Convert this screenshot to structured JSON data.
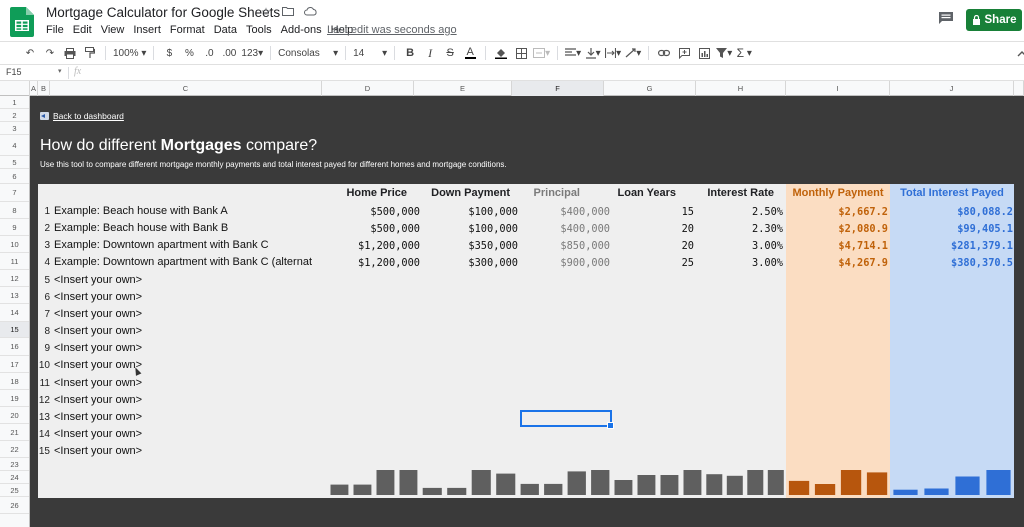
{
  "app": {
    "title": "Mortgage Calculator for Google Sheets",
    "menu": [
      "File",
      "Edit",
      "View",
      "Insert",
      "Format",
      "Data",
      "Tools",
      "Add-ons",
      "Help"
    ],
    "last_edit": "Last edit was seconds ago",
    "share_label": "Share",
    "icons": [
      "star-icon",
      "move-to-folder-icon",
      "cloud-status-icon",
      "comment-history-icon"
    ]
  },
  "toolbar": {
    "zoom": "100%",
    "currency": "$",
    "percent": "%",
    "dec_decrease": ".0",
    "dec_increase": ".00",
    "more_formats": "123",
    "font": "Consolas",
    "font_size": "14",
    "bold": "B",
    "italic": "I",
    "strike": "S",
    "text_color": "A",
    "function": "Σ"
  },
  "formula_bar": {
    "cell_ref": "F15",
    "fx": "fx",
    "value": ""
  },
  "columns": [
    "A",
    "B",
    "C",
    "D",
    "E",
    "F",
    "G",
    "H",
    "I",
    "J"
  ],
  "selected_column": "F",
  "rows": [
    "1",
    "2",
    "3",
    "4",
    "5",
    "6",
    "7",
    "8",
    "9",
    "10",
    "11",
    "12",
    "13",
    "14",
    "15",
    "16",
    "17",
    "18",
    "19",
    "20",
    "21",
    "22",
    "23",
    "24",
    "25",
    "26"
  ],
  "selected_row": "15",
  "sheet": {
    "back_link": "Back to dashboard",
    "heading_prefix": "How do different ",
    "heading_bold": "Mortgages",
    "heading_suffix": " compare?",
    "subheading": "Use this tool to compare different mortgage monthly payments and total interest payed for different homes and mortgage conditions."
  },
  "table": {
    "headers": {
      "home_price": "Home Price",
      "down_payment": "Down Payment",
      "principal": "Principal",
      "loan_years": "Loan Years",
      "interest_rate": "Interest Rate",
      "monthly_payment": "Monthly Payment",
      "total_interest": "Total Interest Payed"
    },
    "rows": [
      {
        "idx": "1",
        "name": "Example: Beach house with Bank A",
        "home_price": "$500,000",
        "down_payment": "$100,000",
        "principal": "$400,000",
        "loan_years": "15",
        "interest_rate": "2.50%",
        "monthly_payment": "$2,667.2",
        "total_interest": "$80,088.2"
      },
      {
        "idx": "2",
        "name": "Example: Beach house with Bank B",
        "home_price": "$500,000",
        "down_payment": "$100,000",
        "principal": "$400,000",
        "loan_years": "20",
        "interest_rate": "2.30%",
        "monthly_payment": "$2,080.9",
        "total_interest": "$99,405.1"
      },
      {
        "idx": "3",
        "name": "Example: Downtown apartment with Bank C",
        "home_price": "$1,200,000",
        "down_payment": "$350,000",
        "principal": "$850,000",
        "loan_years": "20",
        "interest_rate": "3.00%",
        "monthly_payment": "$4,714.1",
        "total_interest": "$281,379.1"
      },
      {
        "idx": "4",
        "name": "Example: Downtown apartment with Bank C (alternat",
        "home_price": "$1,200,000",
        "down_payment": "$300,000",
        "principal": "$900,000",
        "loan_years": "25",
        "interest_rate": "3.00%",
        "monthly_payment": "$4,267.9",
        "total_interest": "$380,370.5"
      },
      {
        "idx": "5",
        "name": "<Insert your own>"
      },
      {
        "idx": "6",
        "name": "<Insert your own>"
      },
      {
        "idx": "7",
        "name": "<Insert your own>"
      },
      {
        "idx": "8",
        "name": "<Insert your own>"
      },
      {
        "idx": "9",
        "name": "<Insert your own>"
      },
      {
        "idx": "10",
        "name": "<Insert your own>"
      },
      {
        "idx": "11",
        "name": "<Insert your own>"
      },
      {
        "idx": "12",
        "name": "<Insert your own>"
      },
      {
        "idx": "13",
        "name": "<Insert your own>"
      },
      {
        "idx": "14",
        "name": "<Insert your own>"
      },
      {
        "idx": "15",
        "name": "<Insert your own>"
      }
    ]
  },
  "colors": {
    "sheet_bg": "#3a3a3a",
    "panel_bg": "#efefef",
    "monthly_band": "#fbddc2",
    "total_band": "#c6daf5",
    "monthly_text": "#c0620a",
    "total_text": "#2f6fd6",
    "share_green": "#188038",
    "selection_blue": "#1a73e8"
  },
  "chart_data": [
    {
      "type": "bar",
      "series": [
        {
          "values": [
            500000,
            500000,
            1200000,
            1200000
          ]
        }
      ],
      "color": "#5f5f5f"
    },
    {
      "type": "bar",
      "series": [
        {
          "values": [
            100000,
            100000,
            350000,
            300000
          ]
        }
      ],
      "color": "#5f5f5f"
    },
    {
      "type": "bar",
      "series": [
        {
          "values": [
            400000,
            400000,
            850000,
            900000
          ]
        }
      ],
      "color": "#5f5f5f"
    },
    {
      "type": "bar",
      "series": [
        {
          "values": [
            15,
            20,
            20,
            25
          ]
        }
      ],
      "color": "#5f5f5f"
    },
    {
      "type": "bar",
      "series": [
        {
          "values": [
            2.5,
            2.3,
            3.0,
            3.0
          ]
        }
      ],
      "color": "#5f5f5f"
    },
    {
      "type": "bar",
      "series": [
        {
          "values": [
            2667.2,
            2080.9,
            4714.1,
            4267.9
          ]
        }
      ],
      "color": "#b7560d"
    },
    {
      "type": "bar",
      "series": [
        {
          "values": [
            80088.2,
            99405.1,
            281379.1,
            380370.5
          ]
        }
      ],
      "color": "#2f6fd6"
    }
  ]
}
